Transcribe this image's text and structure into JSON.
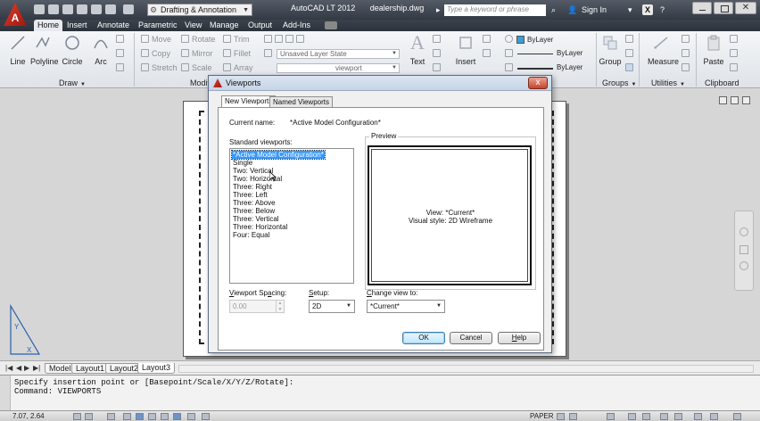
{
  "titlebar": {
    "app_logo": "A",
    "workspace": "Drafting & Annotation",
    "app_name": "AutoCAD LT 2012",
    "file_name": "dealership.dwg",
    "search_placeholder": "Type a keyword or phrase",
    "sign_in": "Sign In",
    "help_label": "?",
    "close_glyph": "X"
  },
  "ribbon_tabs": [
    "Home",
    "Insert",
    "Annotate",
    "Parametric",
    "View",
    "Manage",
    "Output",
    "Add-Ins"
  ],
  "active_ribbon_tab": "Home",
  "ribbon": {
    "draw_tools": [
      "Line",
      "Polyline",
      "Circle",
      "Arc"
    ],
    "modify_tools": [
      [
        "Move",
        "Rotate",
        "Trim"
      ],
      [
        "Copy",
        "Mirror",
        "Fillet"
      ],
      [
        "Stretch",
        "Scale",
        "Array"
      ]
    ],
    "layer_state": "Unsaved Layer State",
    "layer_combo": "viewport",
    "text_tool": "Text",
    "insert_tool": "Insert",
    "bylayer_color": "ByLayer",
    "bylayer_linetype": "ByLayer",
    "bylayer_lineweight": "ByLayer",
    "group_tool": "Group",
    "measure_tool": "Measure",
    "paste_tool": "Paste",
    "panels": {
      "draw": "Draw",
      "modify": "Modify",
      "groups": "Groups",
      "utilities": "Utilities",
      "clipboard": "Clipboard"
    }
  },
  "layout_tabs": [
    "Model",
    "Layout1",
    "Layout2",
    "Layout3"
  ],
  "active_layout_tab": "Layout3",
  "command_line": {
    "line1": "Specify insertion point or [Basepoint/Scale/X/Y/Z/Rotate]:",
    "line2": "Command: VIEWPORTS"
  },
  "statusbar": {
    "coords": "7.07, 2.64",
    "paper": "PAPER"
  },
  "dialog": {
    "title": "Viewports",
    "close_glyph": "x",
    "tabs": [
      "New Viewports",
      "Named Viewports"
    ],
    "active_tab": "New Viewports",
    "current_name_label": "Current name:",
    "current_name_value": "*Active Model Configuration*",
    "standard_label": "Standard viewports:",
    "standard_viewports": [
      "*Active Model Configuration*",
      "Single",
      "Two:  Vertical",
      "Two:  Horizontal",
      "Three: Right",
      "Three: Left",
      "Three: Above",
      "Three: Below",
      "Three: Vertical",
      "Three: Horizontal",
      "Four:  Equal"
    ],
    "selected_index": 0,
    "preview_label": "Preview",
    "preview_view": "View: *Current*",
    "preview_style": "Visual style: 2D Wireframe",
    "spacing_label": "Viewport Spacing:",
    "spacing_value": "0.00",
    "setup_label": "Setup:",
    "setup_value": "2D",
    "change_view_label": "Change view to:",
    "change_view_value": "*Current*",
    "ok": "OK",
    "cancel": "Cancel",
    "help": "Help"
  },
  "colors": {
    "titlebar": "#3a414b",
    "selection": "#3399ff",
    "autocad_red": "#c8281c"
  }
}
